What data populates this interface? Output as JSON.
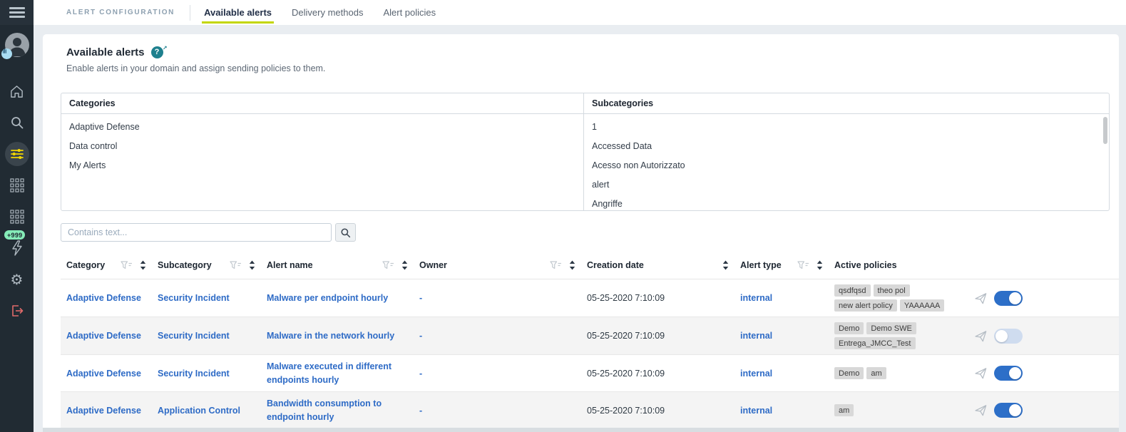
{
  "colors": {
    "accent_yellow": "#c3d600",
    "sidebar_bg": "#212b33",
    "active_icon_yellow": "#f2d600",
    "badge_green": "#85ecb8",
    "logout_red": "#e06a6a",
    "help_teal": "#1e808e",
    "link_blue": "#2e6bc6",
    "toggle_on_blue": "#2d6fc8",
    "chip_gray": "#d8d8d8"
  },
  "sidebar": {
    "nav": [
      {
        "icon": "home"
      },
      {
        "icon": "search"
      },
      {
        "icon": "sliders",
        "active": true
      },
      {
        "icon": "grid"
      },
      {
        "icon": "grid"
      },
      {
        "icon": "bolt",
        "badge": "+999"
      },
      {
        "icon": "gear"
      },
      {
        "icon": "logout"
      }
    ]
  },
  "topbar": {
    "app_title": "ALERT CONFIGURATION",
    "tabs": [
      {
        "label": "Available alerts",
        "active": true
      },
      {
        "label": "Delivery methods",
        "active": false
      },
      {
        "label": "Alert policies",
        "active": false
      }
    ]
  },
  "page": {
    "title": "Available alerts",
    "subtitle": "Enable alerts in your domain and assign sending policies to them."
  },
  "categories_panel": {
    "header": "Categories",
    "items": [
      "Adaptive Defense",
      "Data control",
      "My Alerts"
    ]
  },
  "subcategories_panel": {
    "header": "Subcategories",
    "items": [
      "1",
      "Accessed Data",
      "Acesso non Autorizzato",
      "alert",
      "Angriffe"
    ]
  },
  "search": {
    "placeholder": "Contains text..."
  },
  "table": {
    "columns": [
      {
        "label": "Category",
        "filter": true,
        "sort": true
      },
      {
        "label": "Subcategory",
        "filter": true,
        "sort": true
      },
      {
        "label": "Alert name",
        "filter": true,
        "sort": true
      },
      {
        "label": "Owner",
        "filter": true,
        "sort": true
      },
      {
        "label": "Creation date",
        "filter": false,
        "sort": true
      },
      {
        "label": "Alert type",
        "filter": true,
        "sort": true
      },
      {
        "label": "Active policies",
        "filter": false,
        "sort": false
      }
    ],
    "rows": [
      {
        "category": "Adaptive Defense",
        "subcategory": "Security Incident",
        "alert_name": "Malware per endpoint hourly",
        "owner": "-",
        "creation_date": "05-25-2020 7:10:09",
        "alert_type": "internal",
        "policies": [
          "qsdfqsd",
          "theo pol",
          "new alert policy",
          "YAAAAAA"
        ],
        "enabled": true
      },
      {
        "category": "Adaptive Defense",
        "subcategory": "Security Incident",
        "alert_name": "Malware in the network hourly",
        "owner": "-",
        "creation_date": "05-25-2020 7:10:09",
        "alert_type": "internal",
        "policies": [
          "Demo",
          "Demo SWE",
          "Entrega_JMCC_Test"
        ],
        "enabled": false
      },
      {
        "category": "Adaptive Defense",
        "subcategory": "Security Incident",
        "alert_name": "Malware executed in different endpoints hourly",
        "owner": "-",
        "creation_date": "05-25-2020 7:10:09",
        "alert_type": "internal",
        "policies": [
          "Demo",
          "am"
        ],
        "enabled": true
      },
      {
        "category": "Adaptive Defense",
        "subcategory": "Application Control",
        "alert_name": "Bandwidth consumption to endpoint hourly",
        "owner": "-",
        "creation_date": "05-25-2020 7:10:09",
        "alert_type": "internal",
        "policies": [
          "am"
        ],
        "enabled": true
      }
    ]
  }
}
